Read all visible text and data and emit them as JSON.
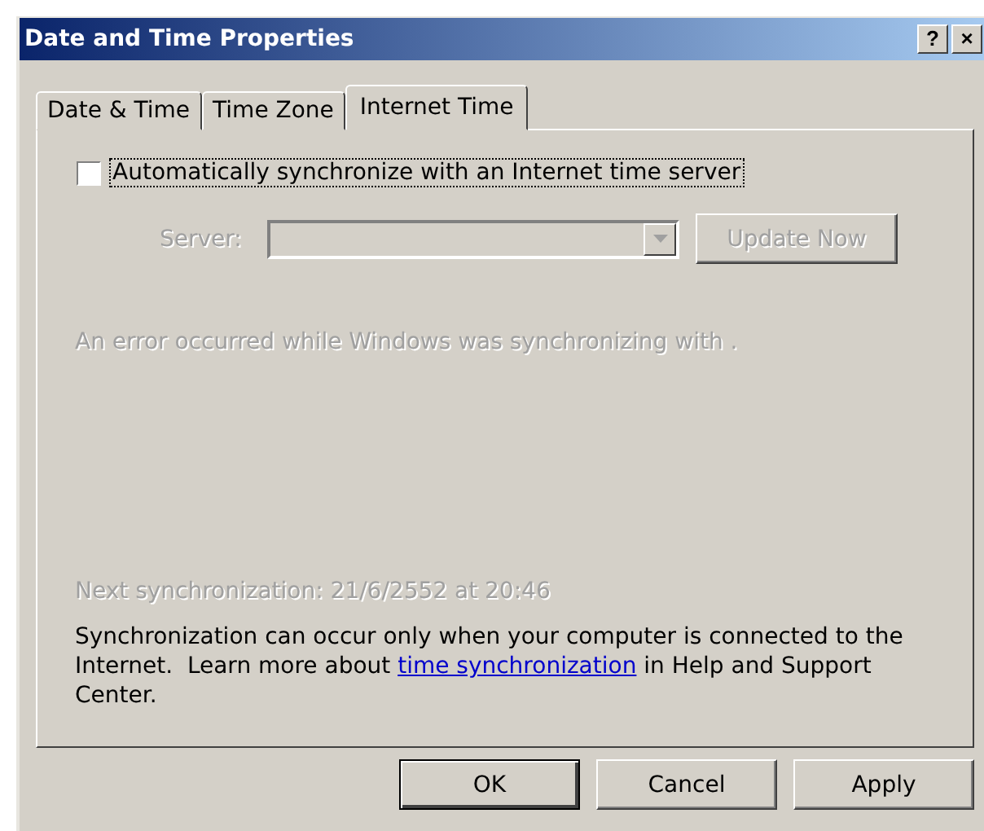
{
  "window": {
    "title": "Date and Time Properties",
    "help_button": "?",
    "close_button": "×"
  },
  "tabs": [
    {
      "label": "Date & Time",
      "selected": false
    },
    {
      "label": "Time Zone",
      "selected": false
    },
    {
      "label": "Internet Time",
      "selected": true
    }
  ],
  "auto_sync": {
    "label": "Automatically synchronize with an Internet time server",
    "checked": false
  },
  "server": {
    "label": "Server:",
    "disabled": true
  },
  "update_button": {
    "label": "Update Now",
    "disabled": true
  },
  "error_message": {
    "text": "An error occurred while Windows was synchronizing with .",
    "disabled": true
  },
  "next_sync": {
    "text": "Next synchronization: 21/6/2552 at 20:46",
    "disabled": true
  },
  "info": {
    "before": "Synchronization can occur only when your computer is connected to the Internet.  Learn more about",
    "link": "time synchronization",
    "after": "in Help and Support Center."
  },
  "buttons": [
    {
      "label": "OK"
    },
    {
      "label": "Cancel"
    },
    {
      "label": "Apply"
    }
  ]
}
